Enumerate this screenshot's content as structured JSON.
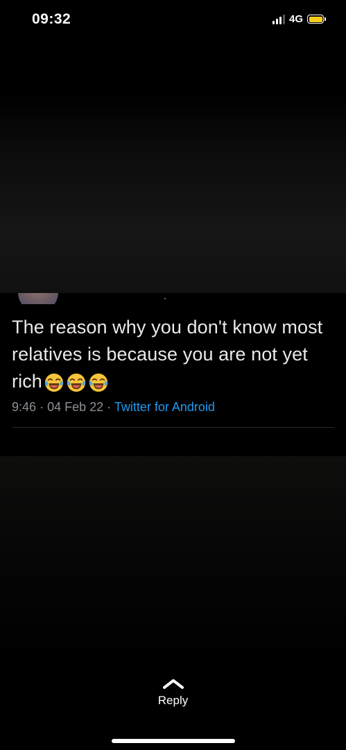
{
  "status_bar": {
    "time": "09:32",
    "network": "4G",
    "signal_bars_active": 3,
    "battery_color": "#f5cd1d"
  },
  "tweet": {
    "text": "The reason why you don't know most relatives is because you are not yet rich",
    "emojis": [
      "face-with-tears-of-joy",
      "face-with-tears-of-joy",
      "face-with-tears-of-joy"
    ],
    "time": "9:46",
    "date": "04 Feb 22",
    "source": "Twitter for Android",
    "source_color": "#1d9bf0"
  },
  "reply": {
    "label": "Reply"
  }
}
